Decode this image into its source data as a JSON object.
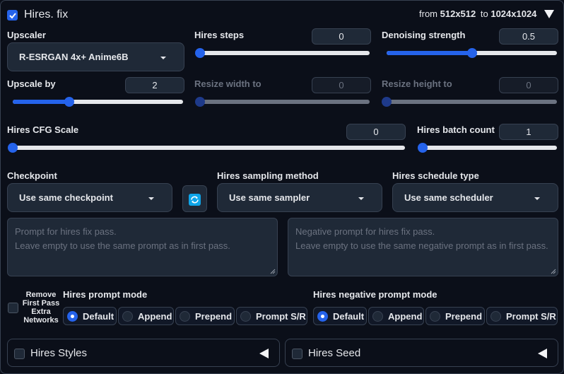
{
  "header": {
    "enabled": true,
    "title": "Hires. fix",
    "from_label": "from",
    "from_size": "512x512",
    "to_label": "to",
    "to_size": "1024x1024"
  },
  "upscaler": {
    "label": "Upscaler",
    "value": "R-ESRGAN 4x+ Anime6B"
  },
  "hires_steps": {
    "label": "Hires steps",
    "value": "0",
    "fraction": 0.0
  },
  "denoising": {
    "label": "Denoising strength",
    "value": "0.5",
    "fraction": 0.5
  },
  "upscale_by": {
    "label": "Upscale by",
    "value": "2",
    "fraction": 0.33
  },
  "resize_width": {
    "label": "Resize width to",
    "value": "0",
    "fraction": 0.0
  },
  "resize_height": {
    "label": "Resize height to",
    "value": "0",
    "fraction": 0.0
  },
  "cfg_scale": {
    "label": "Hires CFG Scale",
    "value": "0",
    "fraction": 0.0
  },
  "batch_count": {
    "label": "Hires batch count",
    "value": "1",
    "fraction": 0.0
  },
  "checkpoint": {
    "label": "Checkpoint",
    "value": "Use same checkpoint"
  },
  "sampler": {
    "label": "Hires sampling method",
    "value": "Use same sampler"
  },
  "scheduler": {
    "label": "Hires schedule type",
    "value": "Use same scheduler"
  },
  "prompt": {
    "line1": "Prompt for hires fix pass.",
    "line2": "Leave empty to use the same prompt as in first pass."
  },
  "negative_prompt": {
    "line1": "Negative prompt for hires fix pass.",
    "line2": "Leave empty to use the same negative prompt as in first pass."
  },
  "remove_extra_networks": {
    "checked": false,
    "line1": "Remove",
    "line2": "First Pass",
    "line3": "Extra",
    "line4": "Networks"
  },
  "prompt_mode": {
    "label": "Hires prompt mode",
    "options": [
      "Default",
      "Append",
      "Prepend",
      "Prompt S/R"
    ],
    "selected": "Default"
  },
  "negative_prompt_mode": {
    "label": "Hires negative prompt mode",
    "options": [
      "Default",
      "Append",
      "Prepend",
      "Prompt S/R"
    ],
    "selected": "Default"
  },
  "accordions": {
    "styles": "Hires Styles",
    "seed": "Hires Seed"
  },
  "colors": {
    "accent": "#2563eb",
    "background": "#0b0f19",
    "input_bg": "#1f2937",
    "refresh_icon": "#0ea5e9"
  },
  "icons": {
    "collapse": "triangle-down-icon",
    "refresh": "refresh-icon",
    "expand": "triangle-left-icon"
  }
}
